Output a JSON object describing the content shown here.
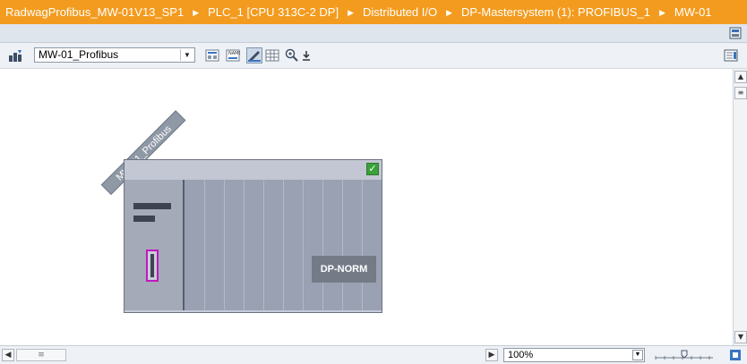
{
  "breadcrumb": {
    "items": [
      "RadwagProfibus_MW-01V13_SP1",
      "PLC_1 [CPU 313C-2 DP]",
      "Distributed I/O",
      "DP-Mastersystem (1): PROFIBUS_1",
      "MW-01"
    ],
    "separator": "▶",
    "background": "#f39b1e"
  },
  "toolbar": {
    "device_select_value": "MW-01_Profibus",
    "icons": [
      "device-view-icon",
      "network-overview-icon",
      "show-address-icon",
      "draw-toggle-icon",
      "table-icon",
      "zoom-icon",
      "save-layout-icon"
    ]
  },
  "canvas": {
    "device_label": "MW-01_Profibus",
    "module_label": "DP-NORM",
    "status": "configured-ok",
    "colors": {
      "rack": "#c6cad9",
      "module": "#747b87",
      "connector_highlight": "#c019c0",
      "ok": "#3aa13a"
    }
  },
  "bottom": {
    "zoom_value": "100%"
  }
}
